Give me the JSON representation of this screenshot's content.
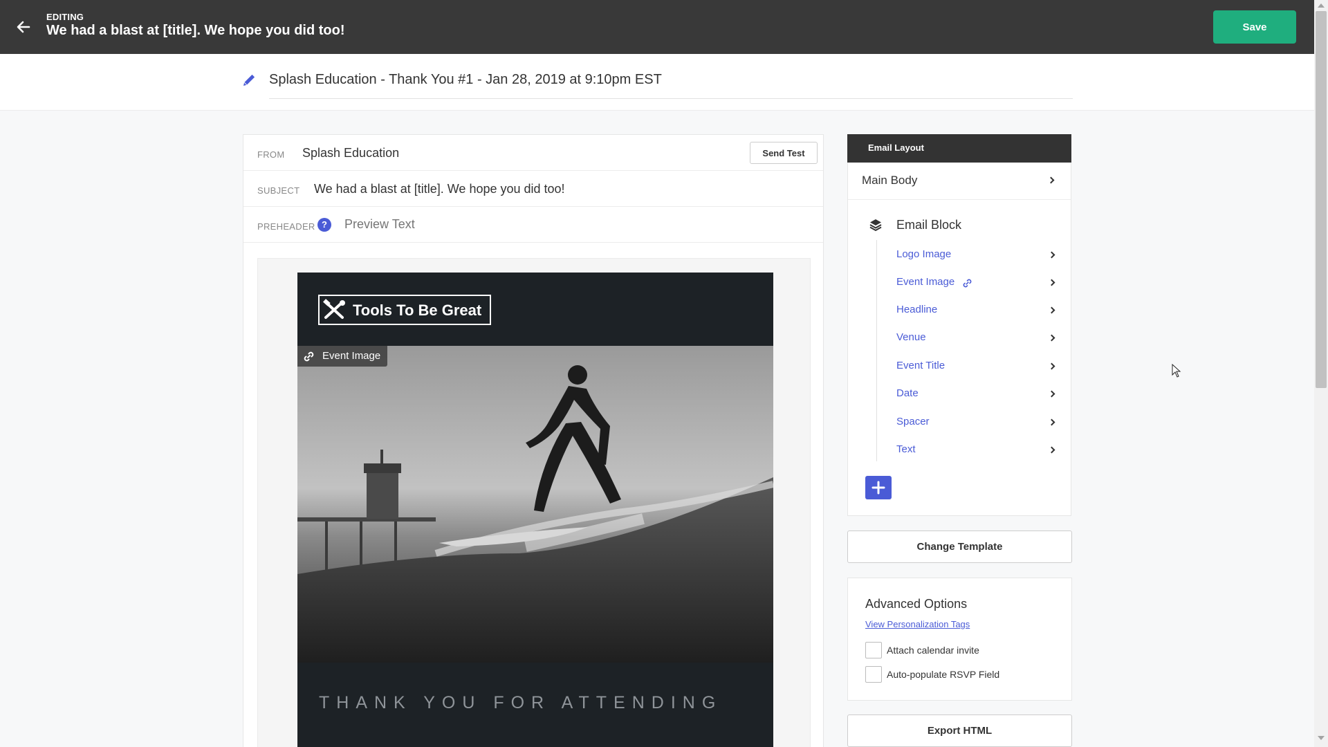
{
  "header": {
    "editing_label": "EDITING",
    "title": "We had a blast at [title]. We hope you did too!",
    "save_label": "Save"
  },
  "campaign": {
    "name": "Splash Education - Thank You #1 - Jan 28, 2019 at 9:10pm EST"
  },
  "fields": {
    "from_label": "FROM",
    "from_value": "Splash Education",
    "send_test_label": "Send Test",
    "subject_label": "SUBJECT",
    "subject_value": "We had a blast at [title]. We hope you did too!",
    "preheader_label": "PREHEADER",
    "preheader_help": "?",
    "preheader_placeholder": "Preview Text"
  },
  "email_preview": {
    "logo_text": "Tools To Be Great",
    "event_image_tag": "Event Image",
    "footer_text": "THANK YOU FOR ATTENDING"
  },
  "layout": {
    "header": "Email Layout",
    "main_body": "Main Body",
    "block_title": "Email Block",
    "items": [
      {
        "label": "Logo Image"
      },
      {
        "label": "Event Image"
      },
      {
        "label": "Headline"
      },
      {
        "label": "Venue"
      },
      {
        "label": "Event Title"
      },
      {
        "label": "Date"
      },
      {
        "label": "Spacer"
      },
      {
        "label": "Text"
      }
    ]
  },
  "actions": {
    "change_template": "Change Template",
    "export_html": "Export HTML"
  },
  "advanced": {
    "title": "Advanced Options",
    "personalization_link": "View Personalization Tags",
    "options": [
      {
        "label": "Attach calendar invite",
        "checked": false
      },
      {
        "label": "Auto-populate RSVP Field",
        "checked": false
      }
    ]
  },
  "colors": {
    "topbar": "#393939",
    "save": "#1fae7e",
    "accent": "#4a5bd6",
    "email_dark": "#1d2226"
  }
}
